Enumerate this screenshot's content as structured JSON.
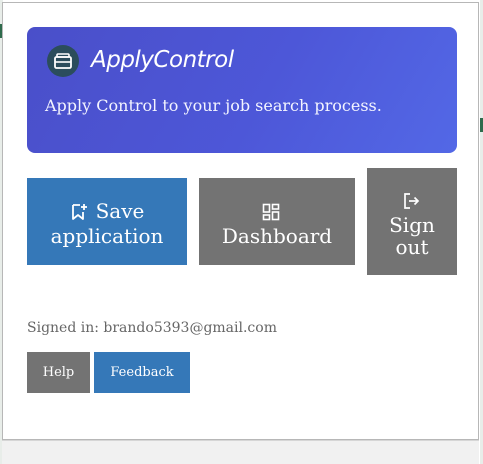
{
  "app": {
    "brand_name": "ApplyControl",
    "tagline": "Apply Control to your job search process.",
    "logo_icon": "briefcase-icon"
  },
  "actions": {
    "save": {
      "line1": "Save",
      "line2": "application",
      "icon": "bookmark-add-icon",
      "color": "#3578b8"
    },
    "dashboard": {
      "label": "Dashboard",
      "icon": "dashboard-grid-icon",
      "color": "#737373"
    },
    "signout": {
      "label": "Sign\nout",
      "icon": "logout-icon",
      "color": "#737373"
    }
  },
  "account": {
    "signed_in_text": "Signed in: brando5393@gmail.com"
  },
  "footer": {
    "help_label": "Help",
    "feedback_label": "Feedback"
  },
  "colors": {
    "hero_gradient_start": "#4a4fc9",
    "hero_gradient_end": "#5368e6",
    "primary": "#3578b8",
    "secondary": "#737373"
  }
}
